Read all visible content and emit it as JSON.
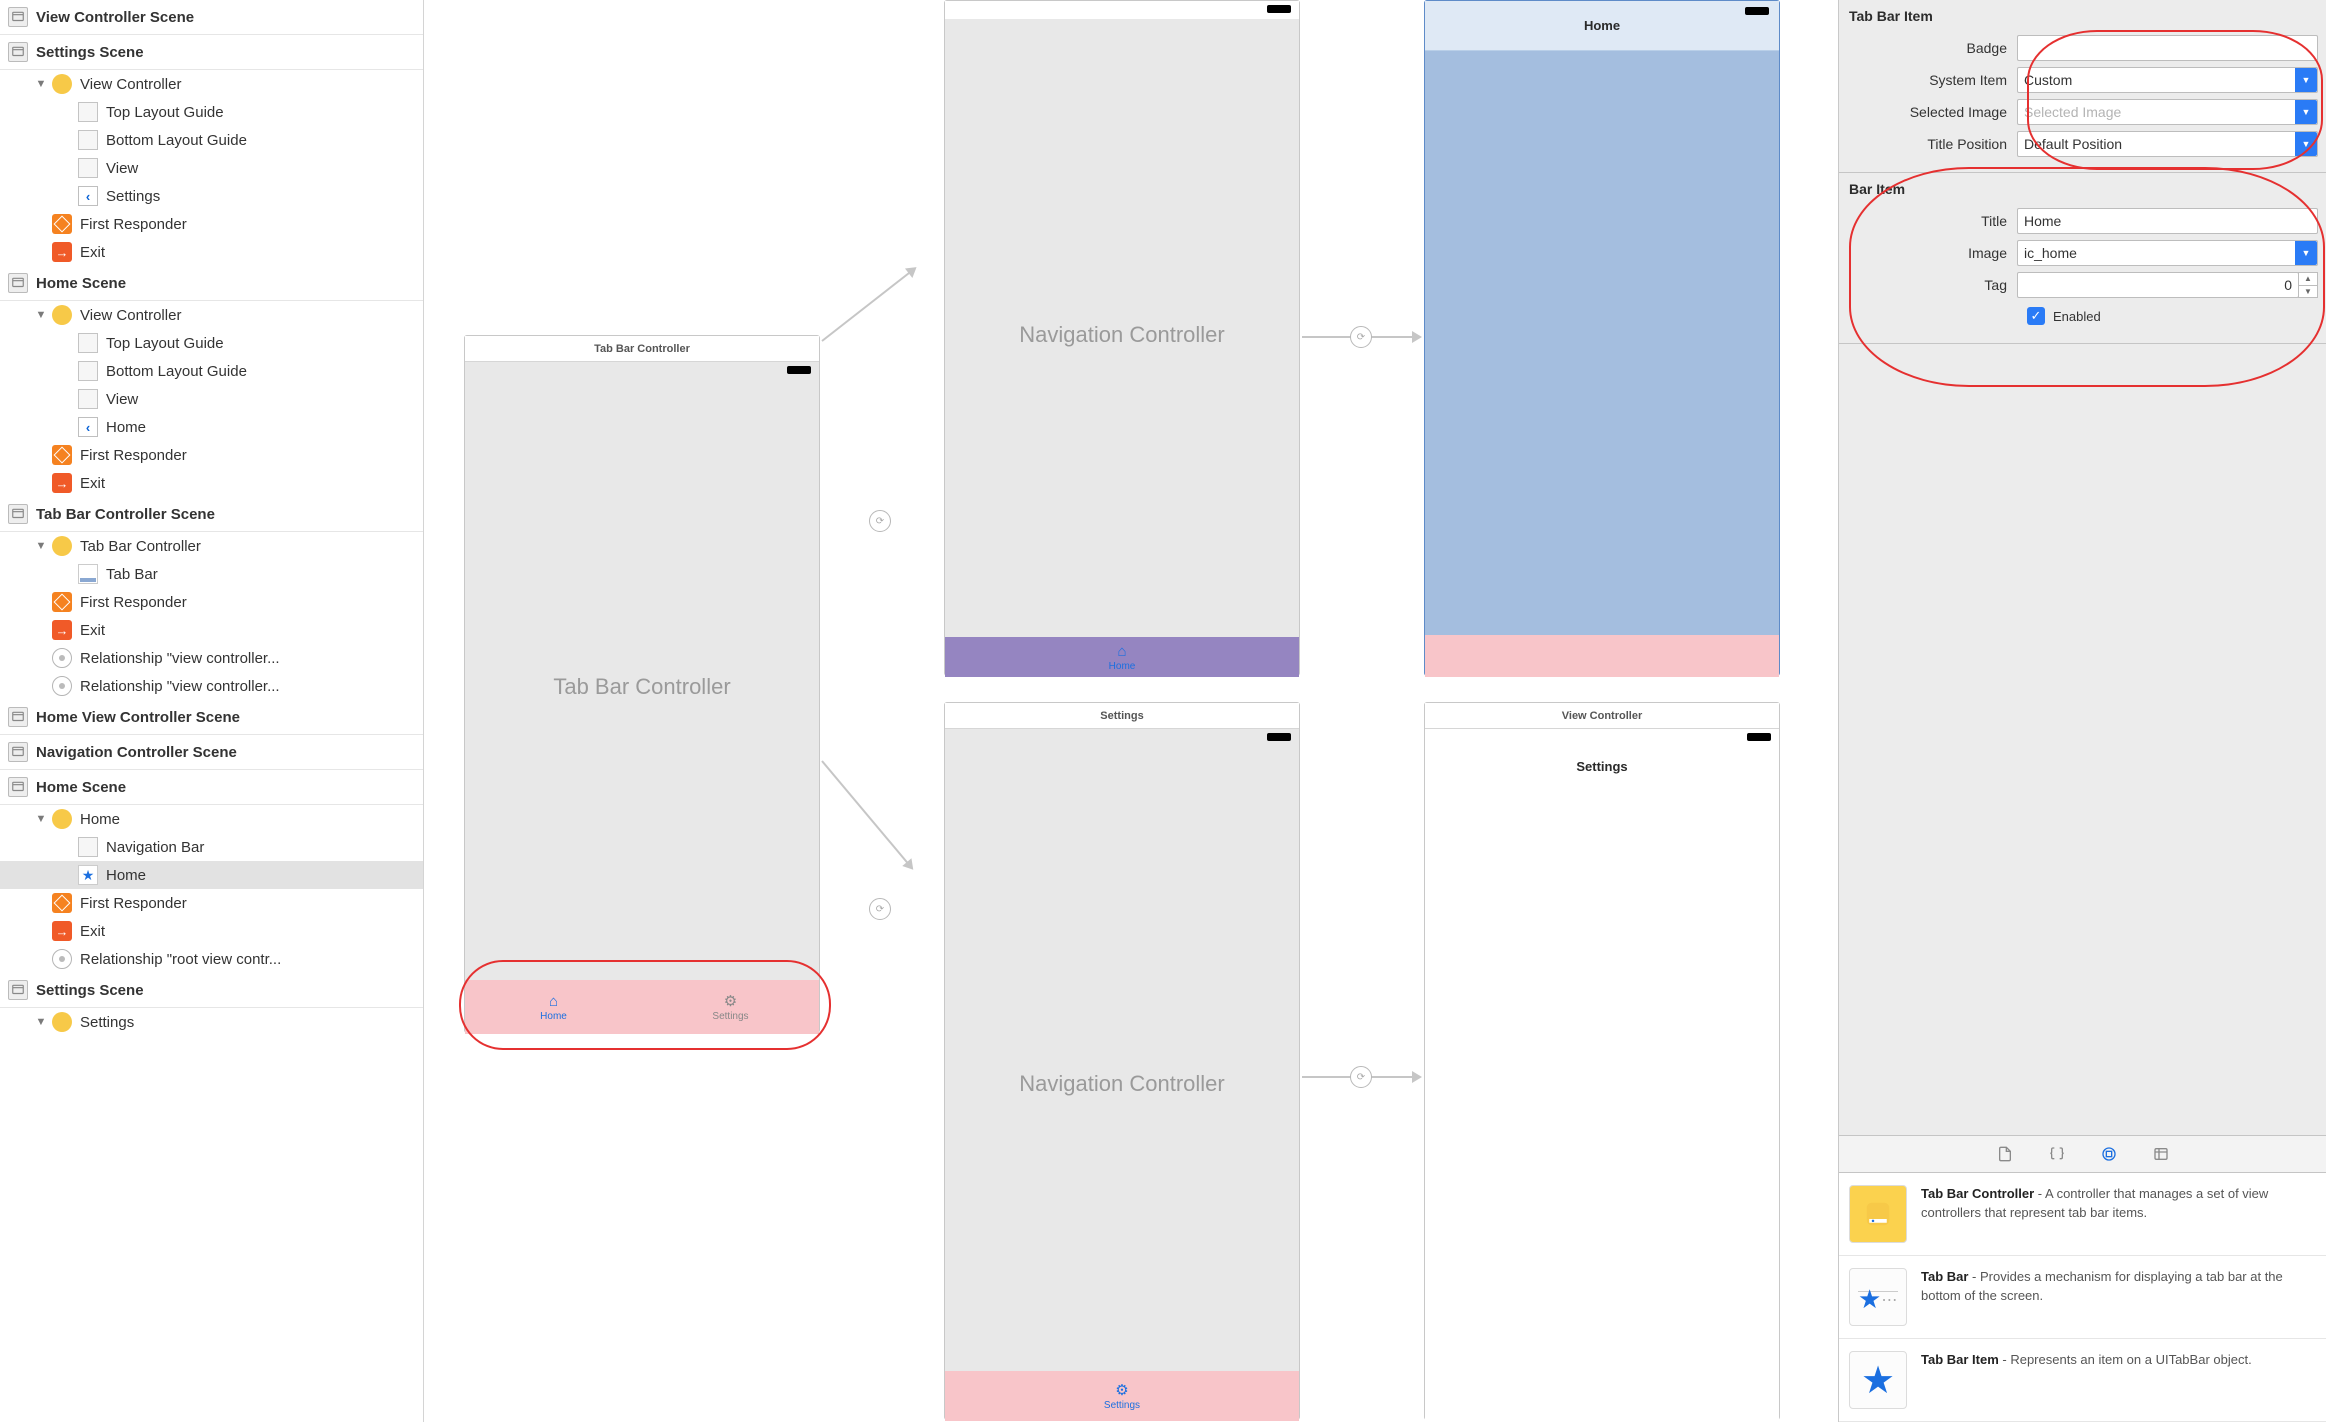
{
  "outline": {
    "scenes": [
      {
        "title": "View Controller Scene",
        "items": []
      },
      {
        "title": "Settings Scene",
        "items": [
          {
            "label": "View Controller",
            "icon": "circle-yellow",
            "depth": 1,
            "disclosure": "▼"
          },
          {
            "label": "Top Layout Guide",
            "icon": "box-gray",
            "depth": 2
          },
          {
            "label": "Bottom Layout Guide",
            "icon": "box-gray",
            "depth": 2
          },
          {
            "label": "View",
            "icon": "box-gray",
            "depth": 2
          },
          {
            "label": "Settings",
            "icon": "back",
            "depth": 2
          },
          {
            "label": "First Responder",
            "icon": "cube-orange",
            "depth": 1
          },
          {
            "label": "Exit",
            "icon": "exit-orange",
            "depth": 1
          }
        ]
      },
      {
        "title": "Home Scene",
        "items": [
          {
            "label": "View Controller",
            "icon": "circle-yellow",
            "depth": 1,
            "disclosure": "▼"
          },
          {
            "label": "Top Layout Guide",
            "icon": "box-gray",
            "depth": 2
          },
          {
            "label": "Bottom Layout Guide",
            "icon": "box-gray",
            "depth": 2
          },
          {
            "label": "View",
            "icon": "box-gray",
            "depth": 2
          },
          {
            "label": "Home",
            "icon": "back",
            "depth": 2
          },
          {
            "label": "First Responder",
            "icon": "cube-orange",
            "depth": 1
          },
          {
            "label": "Exit",
            "icon": "exit-orange",
            "depth": 1
          }
        ]
      },
      {
        "title": "Tab Bar Controller Scene",
        "items": [
          {
            "label": "Tab Bar Controller",
            "icon": "circle-yellow",
            "depth": 1,
            "disclosure": "▼"
          },
          {
            "label": "Tab Bar",
            "icon": "tab",
            "depth": 2
          },
          {
            "label": "First Responder",
            "icon": "cube-orange",
            "depth": 1
          },
          {
            "label": "Exit",
            "icon": "exit-orange",
            "depth": 1
          },
          {
            "label": "Relationship \"view controller...",
            "icon": "ring",
            "depth": 1
          },
          {
            "label": "Relationship \"view controller...",
            "icon": "ring",
            "depth": 1
          }
        ]
      },
      {
        "title": "Home View Controller Scene",
        "items": []
      },
      {
        "title": "Navigation Controller Scene",
        "items": []
      },
      {
        "title": "Home Scene",
        "items": [
          {
            "label": "Home",
            "icon": "circle-yellow",
            "depth": 1,
            "disclosure": "▼"
          },
          {
            "label": "Navigation Bar",
            "icon": "box-gray",
            "depth": 2
          },
          {
            "label": "Home",
            "icon": "star",
            "depth": 2,
            "selected": true
          },
          {
            "label": "First Responder",
            "icon": "cube-orange",
            "depth": 1
          },
          {
            "label": "Exit",
            "icon": "exit-orange",
            "depth": 1
          },
          {
            "label": "Relationship \"root view contr...",
            "icon": "ring",
            "depth": 1
          }
        ]
      },
      {
        "title": "Settings Scene",
        "items": [
          {
            "label": "Settings",
            "icon": "circle-yellow",
            "depth": 1,
            "disclosure": "▼",
            "partial": true
          }
        ]
      }
    ]
  },
  "canvas": {
    "tabbar_scene": {
      "title": "Tab Bar Controller",
      "big_label": "Tab Bar Controller",
      "tabs": [
        {
          "label": "Home",
          "icon": "home",
          "active": true
        },
        {
          "label": "Settings",
          "icon": "settings",
          "active": false
        }
      ]
    },
    "nav_top": {
      "big_label": "Navigation Controller",
      "tab_label": "Home"
    },
    "nav_bottom": {
      "title": "Settings",
      "big_label": "Navigation Controller",
      "tab_label": "Settings"
    },
    "home_scene": {
      "nav_title": "Home"
    },
    "view_controller_scene": {
      "title": "View Controller",
      "nav_title": "Settings"
    }
  },
  "inspector": {
    "tabbar_item": {
      "section": "Tab Bar Item",
      "badge_label": "Badge",
      "badge_value": "",
      "system_item_label": "System Item",
      "system_item_value": "Custom",
      "selected_image_label": "Selected Image",
      "selected_image_placeholder": "Selected Image",
      "title_position_label": "Title Position",
      "title_position_value": "Default Position"
    },
    "bar_item": {
      "section": "Bar Item",
      "title_label": "Title",
      "title_value": "Home",
      "image_label": "Image",
      "image_value": "ic_home",
      "tag_label": "Tag",
      "tag_value": "0",
      "enabled_label": "Enabled"
    }
  },
  "library": {
    "items": [
      {
        "title": "Tab Bar Controller",
        "desc": " - A controller that manages a set of view controllers that represent tab bar items.",
        "thumb": "tbc"
      },
      {
        "title": "Tab Bar",
        "desc": " - Provides a mechanism for displaying a tab bar at the bottom of the screen.",
        "thumb": "tb"
      },
      {
        "title": "Tab Bar Item",
        "desc": " - Represents an item on a UITabBar object.",
        "thumb": "tbi"
      }
    ]
  }
}
